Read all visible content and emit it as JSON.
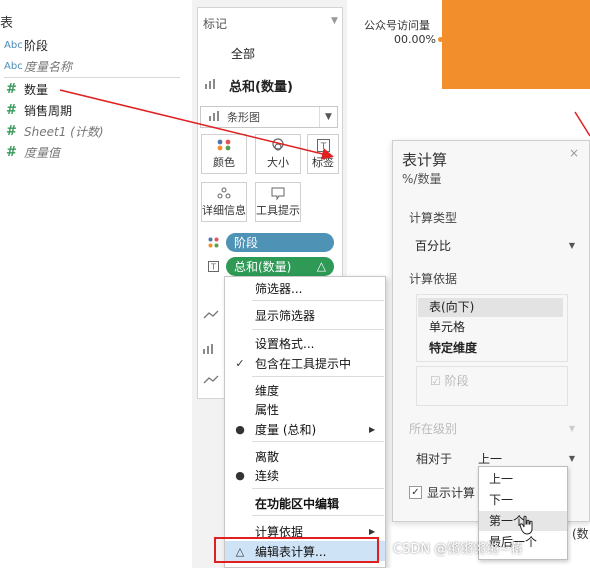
{
  "data_pane": {
    "section_title": "表",
    "fields": [
      {
        "type": "Abc",
        "label": "阶段",
        "italic": false
      },
      {
        "type": "Abc",
        "label": "度量名称",
        "italic": true
      },
      {
        "type": "#",
        "label": "数量",
        "italic": false
      },
      {
        "type": "#",
        "label": "销售周期",
        "italic": false
      },
      {
        "type": "#",
        "label": "Sheet1 (计数)",
        "italic": true
      },
      {
        "type": "#",
        "label": "度量值",
        "italic": true
      }
    ]
  },
  "marks": {
    "title": "标记",
    "all_label": "全部",
    "measure_label": "总和(数量)",
    "mark_type": "条形图",
    "buttons": {
      "color": "颜色",
      "size": "大小",
      "label": "标签",
      "detail": "详细信息",
      "tooltip": "工具提示"
    },
    "pills": {
      "stage": "阶段",
      "sum_quantity": "总和(数量)",
      "delta_symbol": "△"
    }
  },
  "view": {
    "header_text": "公众号访问量",
    "value_text": "00.00%",
    "right_text": "(数"
  },
  "context_menu": {
    "items": [
      {
        "label": "筛选器...",
        "checked": false,
        "bullet": false,
        "submenu": false
      },
      {
        "label": "显示筛选器",
        "checked": false,
        "bullet": false,
        "submenu": false
      },
      {
        "label": "设置格式...",
        "checked": false,
        "bullet": false,
        "submenu": false
      },
      {
        "label": "包含在工具提示中",
        "checked": true,
        "bullet": false,
        "submenu": false
      },
      {
        "label": "维度",
        "checked": false,
        "bullet": false,
        "submenu": false
      },
      {
        "label": "属性",
        "checked": false,
        "bullet": false,
        "submenu": false
      },
      {
        "label": "度量 (总和)",
        "checked": false,
        "bullet": true,
        "submenu": true
      },
      {
        "label": "离散",
        "checked": false,
        "bullet": false,
        "submenu": false
      },
      {
        "label": "连续",
        "checked": false,
        "bullet": true,
        "submenu": false
      },
      {
        "label": "在功能区中编辑",
        "checked": false,
        "bullet": false,
        "submenu": false,
        "bold": true
      },
      {
        "label": "计算依据",
        "checked": false,
        "bullet": false,
        "submenu": true
      },
      {
        "label": "编辑表计算...",
        "checked": false,
        "bullet": false,
        "submenu": false,
        "delta": true,
        "highlighted": true
      }
    ],
    "check_symbol": "✓",
    "bullet_symbol": "●",
    "submenu_symbol": "▶",
    "delta_symbol": "△"
  },
  "table_calc": {
    "title": "表计算",
    "subtitle": "%/数量",
    "close_symbol": "×",
    "calc_type_label": "计算类型",
    "calc_type_value": "百分比",
    "compute_using_label": "计算依据",
    "compute_options": [
      "表(向下)",
      "单元格",
      "特定维度"
    ],
    "dimension_item": "阶段",
    "level_label": "所在级别",
    "relative_to_label": "相对于",
    "relative_to_value": "上一",
    "show_label": "显示计算",
    "relative_options": [
      "上一",
      "下一",
      "第一个",
      "最后一个"
    ]
  },
  "watermark": "CSDN @锵锵锵锵~蒋",
  "colors": {
    "pill_blue": "#4e92b5",
    "pill_green": "#2e9a56",
    "bar_orange": "#f28e2c",
    "highlight_red": "#e02020",
    "menu_highlight": "#cfe3f7"
  }
}
